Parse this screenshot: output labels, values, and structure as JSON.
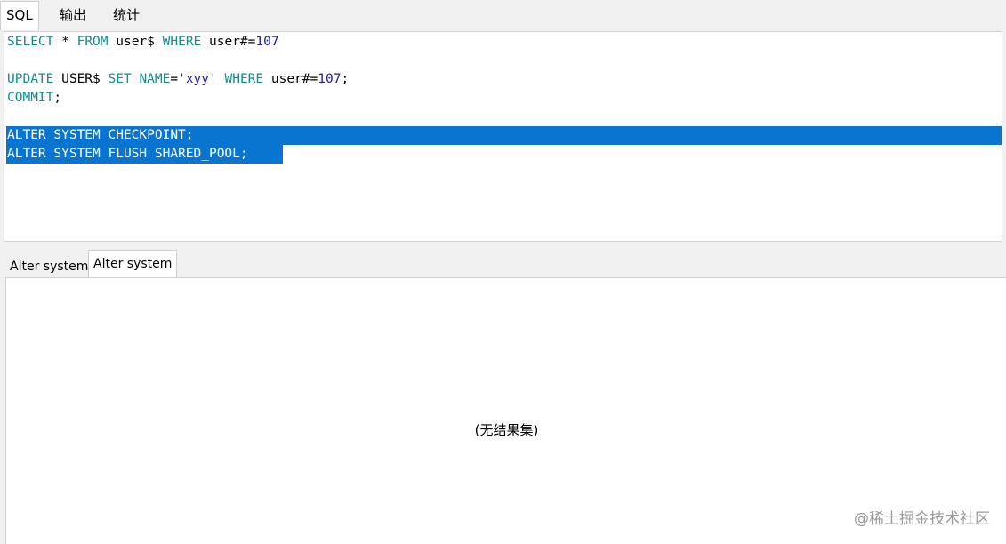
{
  "tabs": {
    "sql": "SQL",
    "output": "输出",
    "stats": "统计"
  },
  "editor": {
    "line1": {
      "kw1": "SELECT",
      "t1": " * ",
      "kw2": "FROM",
      "t2": " user$ ",
      "kw3": "WHERE",
      "t3": " user#=",
      "num": "107"
    },
    "line3": {
      "kw1": "UPDATE",
      "t1": " USER$ ",
      "kw2": "SET",
      "t2": " ",
      "kw3": "NAME",
      "t3": "=",
      "str": "'xyy'",
      "t4": " ",
      "kw4": "WHERE",
      "t5": " user#=",
      "num": "107",
      "t6": ";"
    },
    "line4": {
      "kw1": "COMMIT",
      "t1": ";"
    },
    "line6": "ALTER SYSTEM CHECKPOINT;",
    "line7": "ALTER SYSTEM FLUSH SHARED_POOL;"
  },
  "result_tabs": [
    "Alter system",
    "Alter system"
  ],
  "results": {
    "empty_message": "(无结果集)"
  },
  "watermark": "@稀土掘金技术社区",
  "colors": {
    "keyword": "#0b8f8f",
    "number": "#1c1ca8",
    "selection": "#0a75d1"
  }
}
